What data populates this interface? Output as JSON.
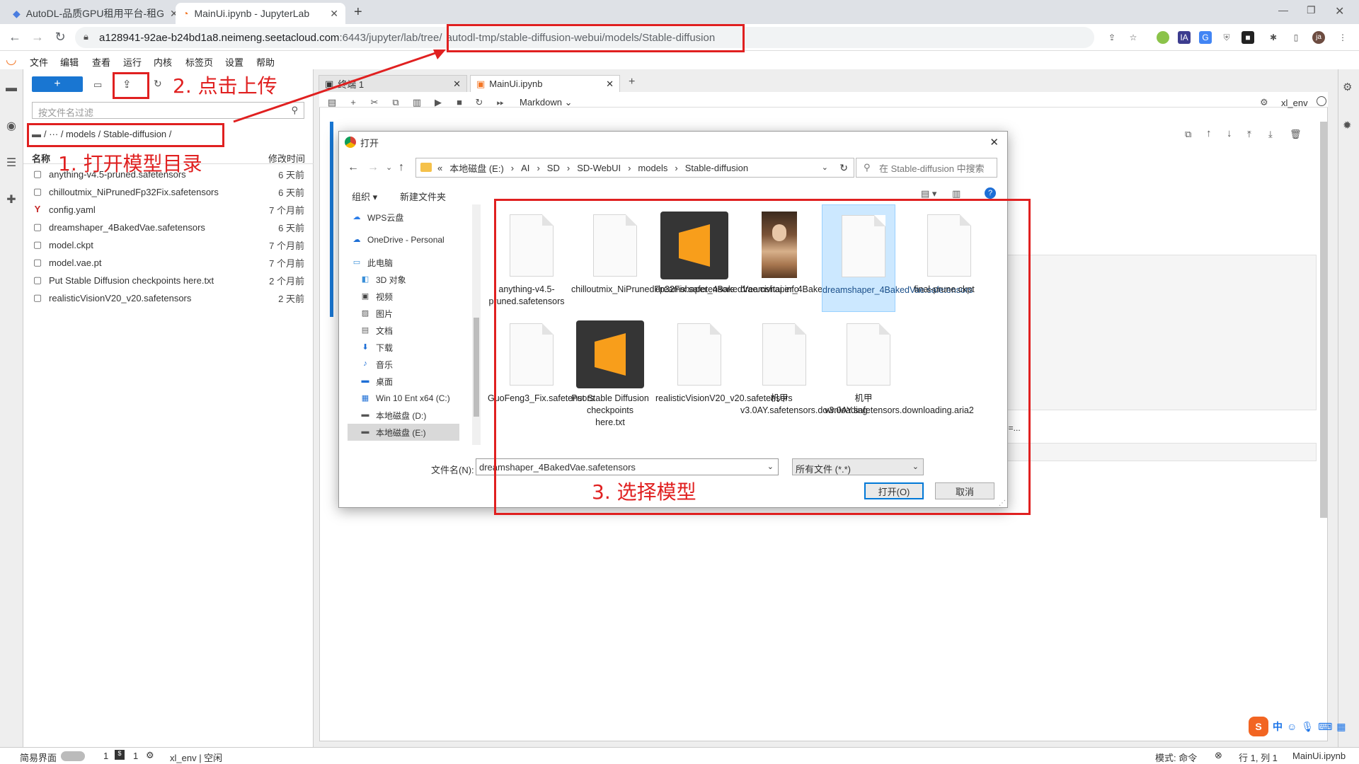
{
  "browser": {
    "tabs": [
      {
        "title": "AutoDL-品质GPU租用平台-租G",
        "close": "✕"
      },
      {
        "title": "MainUi.ipynb - JupyterLab",
        "close": "✕"
      }
    ],
    "new_tab": "+",
    "url_host": "a128941-92ae-b24bd1a8.neimeng.seetacloud.com",
    "url_path": ":6443/jupyter/lab/tree/",
    "url_highlight": "autodl-tmp/stable-diffusion-webui/models/Stable-diffusion",
    "avatar": "ja"
  },
  "jupyter": {
    "menu": [
      "文件",
      "编辑",
      "查看",
      "运行",
      "内核",
      "标签页",
      "设置",
      "帮助"
    ],
    "new_button": "+",
    "filter_placeholder": "按文件名过滤",
    "breadcrumb": "/ ··· / models / Stable-diffusion /",
    "col_name": "名称",
    "col_modified": "修改时间",
    "files": [
      {
        "name": "anything-v4.5-pruned.safetensors",
        "time": "6 天前",
        "icon": "file-icon"
      },
      {
        "name": "chilloutmix_NiPrunedFp32Fix.safetensors",
        "time": "6 天前",
        "icon": "file-icon"
      },
      {
        "name": "config.yaml",
        "time": "7 个月前",
        "icon": "yaml-icon"
      },
      {
        "name": "dreamshaper_4BakedVae.safetensors",
        "time": "6 天前",
        "icon": "file-icon"
      },
      {
        "name": "model.ckpt",
        "time": "7 个月前",
        "icon": "file-icon"
      },
      {
        "name": "model.vae.pt",
        "time": "7 个月前",
        "icon": "file-icon"
      },
      {
        "name": "Put Stable Diffusion checkpoints here.txt",
        "time": "2 个月前",
        "icon": "file-icon"
      },
      {
        "name": "realisticVisionV20_v20.safetensors",
        "time": "2 天前",
        "icon": "file-icon"
      }
    ],
    "doc_tabs": [
      {
        "title": "终端 1",
        "close": "✕"
      },
      {
        "title": "MainUi.ipynb",
        "close": "✕"
      }
    ],
    "cell_type": "Markdown",
    "kernel": "xl_env",
    "status_left": "简易界面",
    "status_count1": "1",
    "status_count2": "1",
    "status_kernel": "xl_env | 空闲",
    "status_mode": "模式: 命令",
    "status_pos": "行 1, 列 1",
    "status_file": "MainUi.ipynb",
    "truncated_text": "e=..."
  },
  "dialog": {
    "title": "打开",
    "close": "✕",
    "address_segments": [
      "«",
      "本地磁盘 (E:)",
      "›",
      "AI",
      "›",
      "SD",
      "›",
      "SD-WebUI",
      "›",
      "models",
      "›",
      "Stable-diffusion"
    ],
    "search_placeholder": "在 Stable-diffusion 中搜索",
    "organize": "组织 ▾",
    "new_folder": "新建文件夹",
    "nav": [
      "WPS云盘",
      "OneDrive - Personal",
      "此电脑",
      "3D 对象",
      "视频",
      "图片",
      "文档",
      "下载",
      "音乐",
      "桌面",
      "Win 10 Ent x64 (C:)",
      "本地磁盘 (D:)",
      "本地磁盘 (E:)"
    ],
    "files": [
      {
        "name": "anything-v4.5-pruned.safetensors",
        "kind": "doc"
      },
      {
        "name": "chilloutmix_NiPrunedFp32Fix.safetensors",
        "kind": "doc"
      },
      {
        "name": "dreamshaper_4BakedVae.civitai.info",
        "kind": "sublime"
      },
      {
        "name": "dreamshaper_4BakedVae.preview.png",
        "kind": "photo"
      },
      {
        "name": "dreamshaper_4BakedVae.safetensors",
        "kind": "doc",
        "selected": true
      },
      {
        "name": "final-prune.ckpt",
        "kind": "doc"
      },
      {
        "name": "GuoFeng3_Fix.safetensors",
        "kind": "doc"
      },
      {
        "name": "Put Stable Diffusion checkpoints here.txt",
        "kind": "sublime"
      },
      {
        "name": "realisticVisionV20_v20.safetensors",
        "kind": "doc"
      },
      {
        "name": "机甲v3.0AY.safetensors.downloading",
        "kind": "doc"
      },
      {
        "name": "机甲v3.0AY.safetensors.downloading.aria2",
        "kind": "doc"
      }
    ],
    "filename_label": "文件名(N):",
    "filename_value": "dreamshaper_4BakedVae.safetensors",
    "filetype": "所有文件 (*.*)",
    "open_button": "打开(O)",
    "cancel_button": "取消"
  },
  "annotations": {
    "step1": "1. 打开模型目录",
    "step2": "2. 点击上传",
    "step3": "3. 选择模型"
  },
  "ime": {
    "label": "中"
  }
}
